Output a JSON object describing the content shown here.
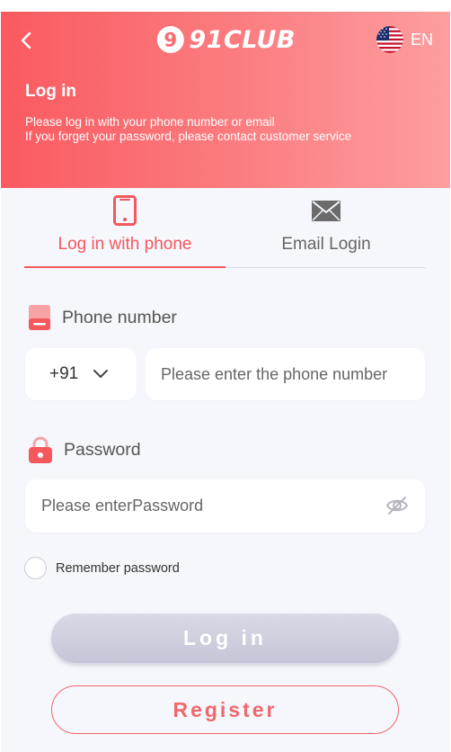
{
  "header": {
    "logo_text": "91CLUB",
    "logo_digit": "9",
    "language": "EN",
    "title": "Log in",
    "desc_line1": "Please log in with your phone number or email",
    "desc_line2": "If you forget your password, please contact customer service"
  },
  "tabs": [
    {
      "label": "Log in with phone",
      "icon": "smartphone-icon",
      "active": true
    },
    {
      "label": "Email Login",
      "icon": "envelope-icon",
      "active": false
    }
  ],
  "form": {
    "phone_label": "Phone number",
    "country_code": "+91",
    "phone_placeholder": "Please enter the phone number",
    "password_label": "Password",
    "password_placeholder": "Please enterPassword",
    "remember_label": "Remember password"
  },
  "buttons": {
    "login": "Log in",
    "register": "Register"
  },
  "colors": {
    "accent": "#f3585d",
    "header_start": "#fa5a5f",
    "header_end": "#fd9e9f",
    "background": "#f6f7fc",
    "login_button": "#c4c6d7"
  }
}
